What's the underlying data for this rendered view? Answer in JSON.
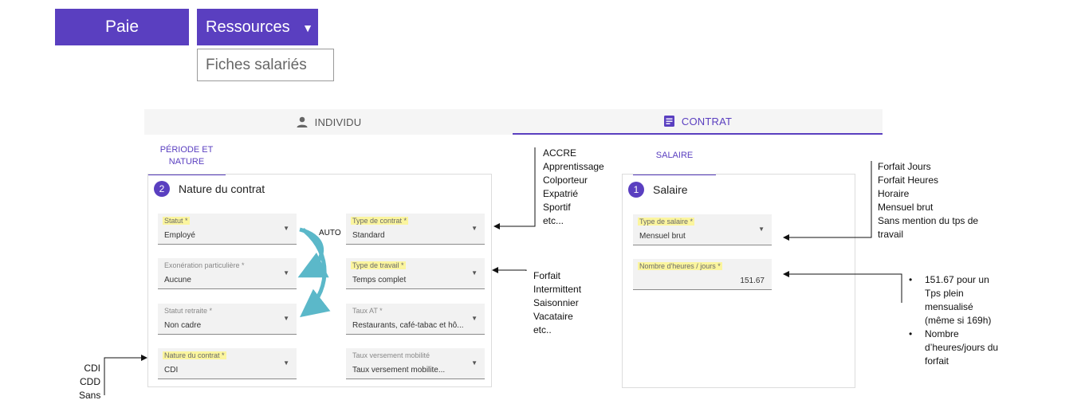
{
  "nav": {
    "paie": "Paie",
    "ressources": "Ressources",
    "fiches_salaries": "Fiches salariés"
  },
  "tabs": {
    "individu": "INDIVIDU",
    "contrat": "CONTRAT"
  },
  "subtabs": {
    "periode_line1": "PÉRIODE ET",
    "periode_line2": "NATURE",
    "salaire": "SALAIRE"
  },
  "nature": {
    "step": "2",
    "title": "Nature du contrat",
    "fields": {
      "statut": {
        "label": "Statut *",
        "value": "Employé"
      },
      "type_contrat": {
        "label": "Type de contrat *",
        "value": "Standard"
      },
      "exoneration": {
        "label": "Exonération particulière *",
        "value": "Aucune"
      },
      "type_travail": {
        "label": "Type de travail *",
        "value": "Temps complet"
      },
      "statut_retraite": {
        "label": "Statut retraite *",
        "value": "Non cadre"
      },
      "taux_at": {
        "label": "Taux AT *",
        "value": "Restaurants, café-tabac et hô..."
      },
      "nature_contrat": {
        "label": "Nature du contrat *",
        "value": "CDI"
      },
      "taux_mobilite": {
        "label": "Taux versement mobilité",
        "value": "Taux versement mobilite..."
      }
    }
  },
  "salaire": {
    "step": "1",
    "title": "Salaire",
    "fields": {
      "type_salaire": {
        "label": "Type de salaire *",
        "value": "Mensuel brut"
      },
      "nb_heures": {
        "label": "Nombre d'heures / jours *",
        "value": "151.67"
      }
    }
  },
  "annotations": {
    "auto": "AUTO",
    "contrat_types": [
      "ACCRE",
      "Apprentissage",
      "Colporteur",
      "Expatrié",
      "Sportif",
      "etc..."
    ],
    "travail_types": [
      "Forfait",
      "Intermittent",
      "Saisonnier",
      "Vacataire",
      "etc.."
    ],
    "nature_types": [
      "CDI",
      "CDD",
      "Sans"
    ],
    "salaire_types": [
      "Forfait Jours",
      "Forfait Heures",
      "Horaire",
      "Mensuel brut",
      "Sans mention du tps de",
      "travail"
    ],
    "heures_bullets": [
      {
        "lines": [
          "151.67 pour un",
          "Tps plein",
          "mensualisé",
          "(même si 169h)"
        ]
      },
      {
        "lines": [
          "Nombre",
          "d’heures/jours du",
          "forfait"
        ]
      }
    ]
  },
  "colors": {
    "accent": "#5a3fc0",
    "highlight": "#fbf59e",
    "auto_arrow": "#5bb8c9"
  }
}
